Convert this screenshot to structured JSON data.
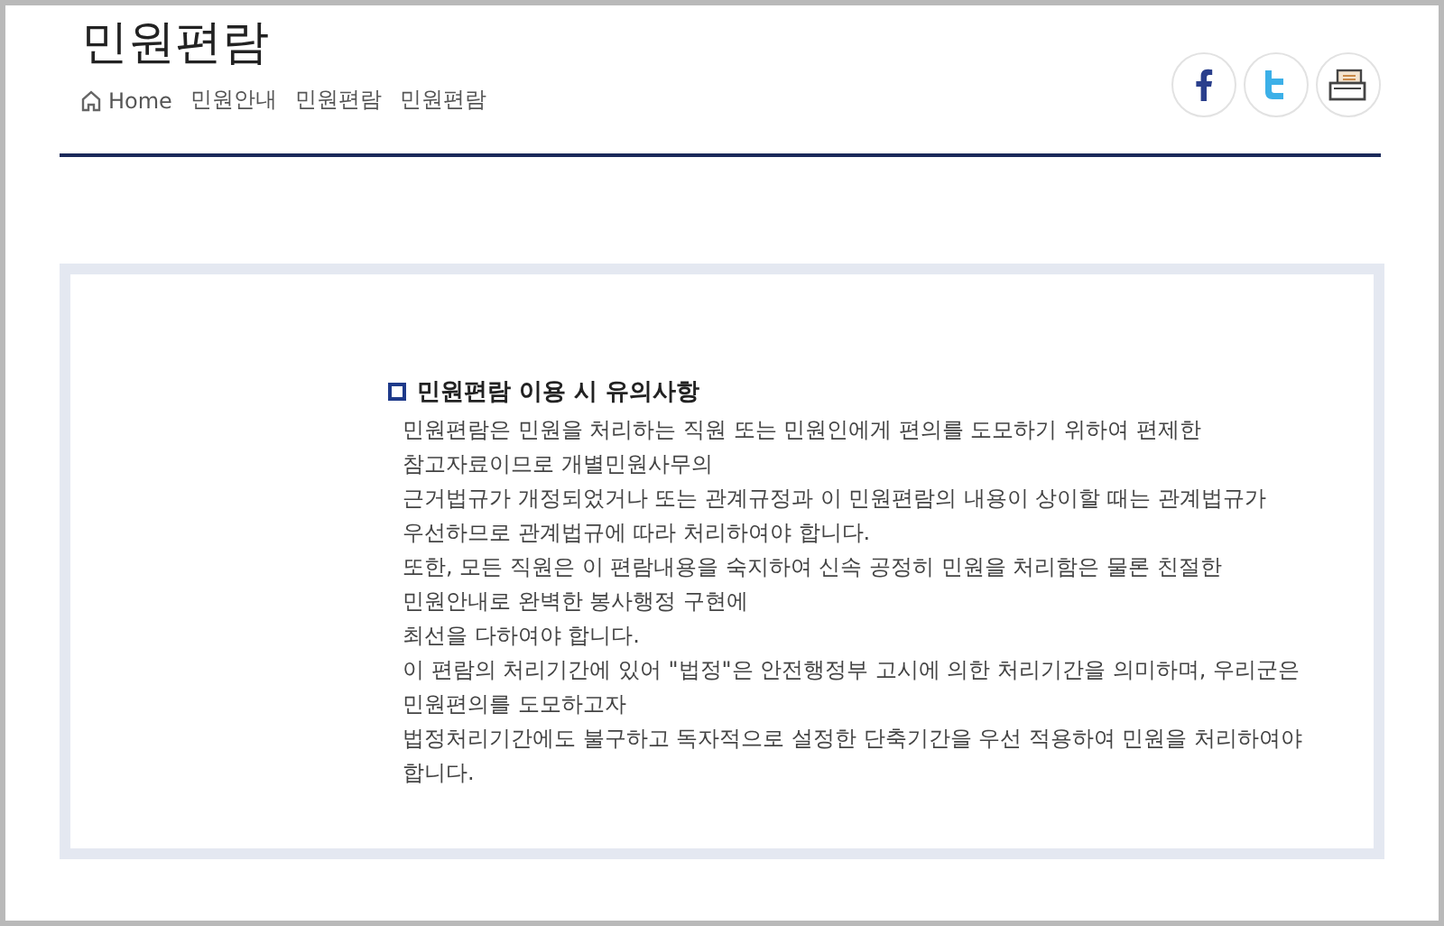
{
  "header": {
    "title": "민원편람",
    "breadcrumb": [
      "Home",
      "민원안내",
      "민원편람",
      "민원편람"
    ]
  },
  "notice": {
    "heading": "민원편람 이용 시 유의사항",
    "lines": [
      "민원편람은 민원을 처리하는 직원 또는 민원인에게 편의를 도모하기 위하여 편제한",
      "참고자료이므로 개별민원사무의",
      "근거법규가 개정되었거나 또는 관계규정과 이 민원편람의 내용이 상이할 때는 관계법규가",
      "우선하므로 관계법규에 따라 처리하여야 합니다.",
      "또한, 모든 직원은 이 편람내용을 숙지하여 신속 공정히 민원을 처리함은 물론 친절한",
      "민원안내로 완벽한 봉사행정 구현에",
      "최선을 다하여야 합니다.",
      "이 편람의 처리기간에 있어 \"법정\"은 안전행정부 고시에 의한 처리기간을 의미하며, 우리군은",
      "민원편의를 도모하고자",
      "법정처리기간에도 불구하고 독자적으로 설정한 단축기간을 우선 적용하여 민원을 처리하여야",
      "합니다."
    ]
  }
}
